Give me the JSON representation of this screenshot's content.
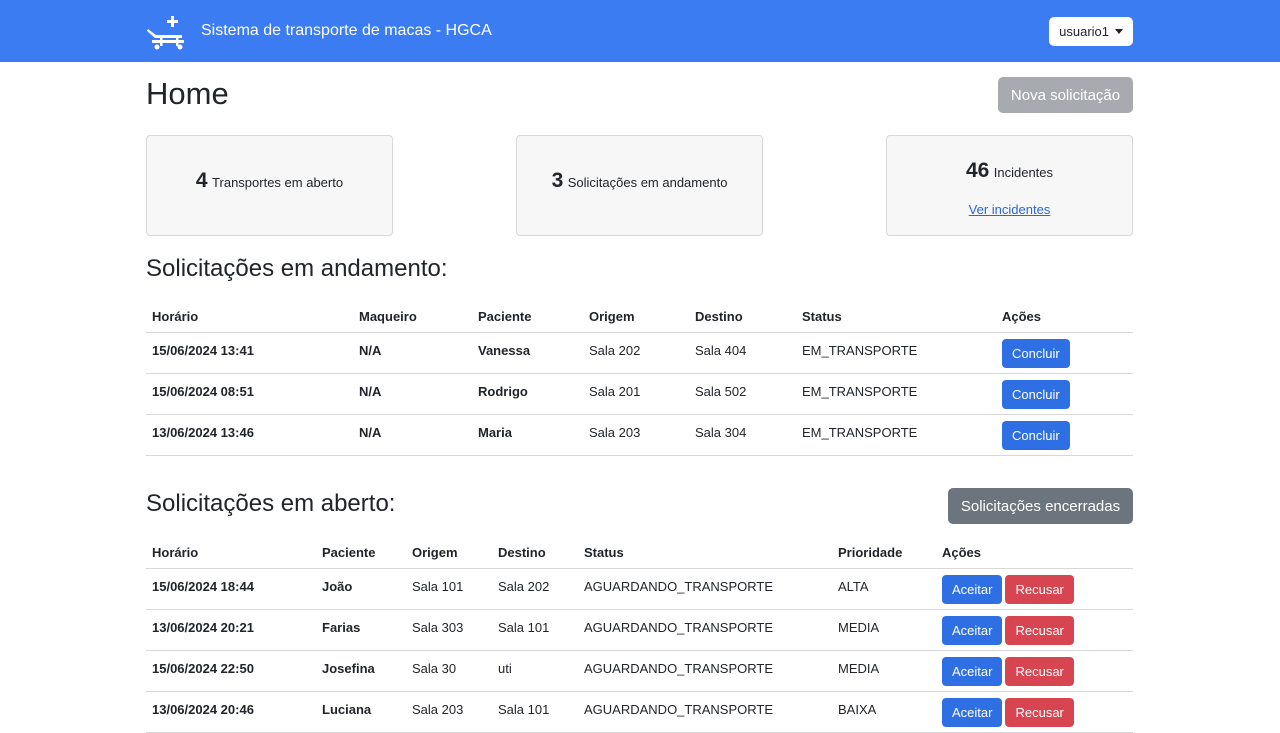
{
  "navbar": {
    "brand_icon": "stretcher-plus-icon",
    "title": "Sistema de transporte de macas - HGCA",
    "user_label": "usuario1",
    "color": "#3b7cf3"
  },
  "page": {
    "title": "Home",
    "new_button": "Nova solicitação"
  },
  "cards": {
    "transportes": {
      "count": "4",
      "label": "Transportes em aberto"
    },
    "solicitacoes": {
      "count": "3",
      "label": "Solicitações em andamento"
    },
    "incidentes": {
      "count": "46",
      "label": "Incidentes",
      "link": "Ver incidentes"
    }
  },
  "andamento": {
    "title": "Solicitações em andamento:",
    "headers": [
      "Horário",
      "Maqueiro",
      "Paciente",
      "Origem",
      "Destino",
      "Status",
      "Ações"
    ],
    "action_label": "Concluir",
    "rows": [
      [
        "15/06/2024 13:41",
        "N/A",
        "Vanessa",
        "Sala 202",
        "Sala 404",
        "EM_TRANSPORTE"
      ],
      [
        "15/06/2024 08:51",
        "N/A",
        "Rodrigo",
        "Sala 201",
        "Sala 502",
        "EM_TRANSPORTE"
      ],
      [
        "13/06/2024 13:46",
        "N/A",
        "Maria",
        "Sala 203",
        "Sala 304",
        "EM_TRANSPORTE"
      ]
    ]
  },
  "aberto": {
    "title": "Solicitações em aberto:",
    "closed_button": "Solicitações encerradas",
    "headers": [
      "Horário",
      "Paciente",
      "Origem",
      "Destino",
      "Status",
      "Prioridade",
      "Ações"
    ],
    "accept_label": "Aceitar",
    "reject_label": "Recusar",
    "rows": [
      [
        "15/06/2024 18:44",
        "João",
        "Sala 101",
        "Sala 202",
        "AGUARDANDO_TRANSPORTE",
        "ALTA"
      ],
      [
        "13/06/2024 20:21",
        "Farias",
        "Sala 303",
        "Sala 101",
        "AGUARDANDO_TRANSPORTE",
        "MEDIA"
      ],
      [
        "15/06/2024 22:50",
        "Josefina",
        "Sala 30",
        "uti",
        "AGUARDANDO_TRANSPORTE",
        "MEDIA"
      ],
      [
        "13/06/2024 20:46",
        "Luciana",
        "Sala 203",
        "Sala 101",
        "AGUARDANDO_TRANSPORTE",
        "BAIXA"
      ]
    ]
  }
}
